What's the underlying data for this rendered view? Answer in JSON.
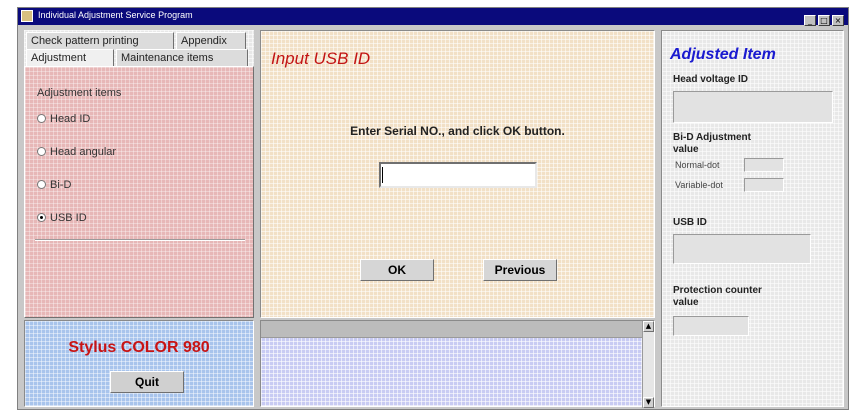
{
  "window": {
    "title": "Individual Adjustment Service Program",
    "buttons": [
      "_",
      "□",
      "×"
    ]
  },
  "tabs": [
    {
      "label": "Check pattern printing",
      "active": false
    },
    {
      "label": "Appendix",
      "active": false
    },
    {
      "label": "Adjustment",
      "active": true
    },
    {
      "label": "Maintenance items",
      "active": false
    }
  ],
  "adjustment": {
    "group_label": "Adjustment items",
    "items": [
      {
        "label": "Head ID",
        "selected": false
      },
      {
        "label": "Head angular",
        "selected": false
      },
      {
        "label": "Bi-D",
        "selected": false
      },
      {
        "label": "USB ID",
        "selected": true
      }
    ]
  },
  "model": {
    "name": "Stylus COLOR 980",
    "quit_label": "Quit"
  },
  "input": {
    "title": "Input USB ID",
    "instruction": "Enter Serial NO., and click OK button.",
    "value": "",
    "ok_label": "OK",
    "previous_label": "Previous"
  },
  "adjusted": {
    "title": "Adjusted Item",
    "head_voltage_label": "Head voltage ID",
    "bid_label_1": "Bi-D Adjustment",
    "bid_label_2": "value",
    "normal_dot_label": "Normal-dot",
    "variable_dot_label": "Variable-dot",
    "usb_id_label": "USB ID",
    "protection_label_1": "Protection counter",
    "protection_label_2": "value"
  },
  "colors": {
    "title_red": "#c21414",
    "title_blue": "#1a1ad0",
    "titlebar": "#0a0a7c"
  }
}
